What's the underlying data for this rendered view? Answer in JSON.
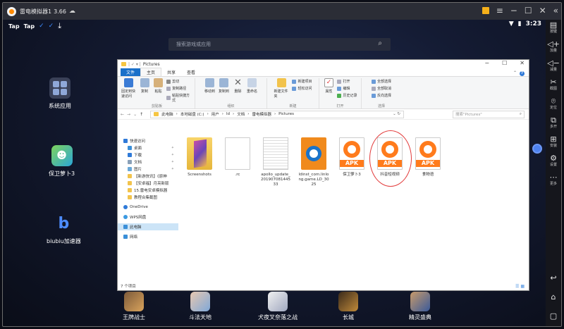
{
  "window": {
    "title": "雷电模拟器1",
    "version": "3.66"
  },
  "statusbar": {
    "app1": "Tap",
    "app2": "Tap",
    "time": "3:23"
  },
  "search": {
    "placeholder": "搜索游戏或应用"
  },
  "desktop": {
    "icons": [
      {
        "label": "系统应用"
      },
      {
        "label": "保卫萝卜3"
      },
      {
        "label": "biubiu加速器"
      }
    ]
  },
  "sidebar": {
    "items": [
      {
        "icon": "keyboard-icon",
        "label": "按键"
      },
      {
        "icon": "volume-up-icon",
        "label": "加量"
      },
      {
        "icon": "volume-down-icon",
        "label": "减量"
      },
      {
        "icon": "scissors-icon",
        "label": "截图"
      },
      {
        "icon": "location-icon",
        "label": "定位"
      },
      {
        "icon": "multi-open-icon",
        "label": "多开"
      },
      {
        "icon": "install-icon",
        "label": "安装"
      },
      {
        "icon": "settings-icon",
        "label": "设置"
      },
      {
        "icon": "more-icon",
        "label": "更多"
      }
    ]
  },
  "explorer": {
    "title": "Pictures",
    "tabs": [
      "文件",
      "主页",
      "共享",
      "查看"
    ],
    "ribbon": {
      "clipboard": {
        "group": "剪贴板",
        "pin": "固定到快速访问",
        "copy": "复制",
        "paste": "粘贴",
        "cut": "剪切",
        "copy_path": "复制路径",
        "paste_shortcut": "粘贴快捷方式"
      },
      "organize": {
        "group": "组织",
        "move_to": "移动到",
        "copy_to": "复制到",
        "delete": "删除",
        "rename": "重命名"
      },
      "new": {
        "group": "新建",
        "new_folder": "新建文件夹",
        "new_item": "新建项目",
        "easy_access": "轻松访问"
      },
      "open": {
        "group": "打开",
        "properties": "属性",
        "open": "打开",
        "edit": "编辑",
        "history": "历史记录"
      },
      "select": {
        "group": "选择",
        "select_all": "全部选择",
        "select_none": "全部取消",
        "invert": "反向选择"
      }
    },
    "address": {
      "crumbs": [
        "此电脑",
        "本地磁盘 (C:)",
        "用户",
        "ld",
        "文档",
        "雷电模拟器",
        "Pictures"
      ],
      "search_placeholder": "搜索\"Pictures\""
    },
    "nav": [
      {
        "label": "快速访问",
        "level": 0
      },
      {
        "label": "桌面",
        "level": 1
      },
      {
        "label": "下载",
        "level": 1
      },
      {
        "label": "文档",
        "level": 1
      },
      {
        "label": "图片",
        "level": 1
      },
      {
        "label": "【新游快讯】《原神",
        "level": 1
      },
      {
        "label": "【安卓福】月亮新版",
        "level": 1
      },
      {
        "label": "15.雷电安卓模拟器",
        "level": 1
      },
      {
        "label": "教程合集截图",
        "level": 1
      },
      {
        "label": "OneDrive",
        "level": 0
      },
      {
        "label": "WPS网盘",
        "level": 0
      },
      {
        "label": "此电脑",
        "level": 0
      },
      {
        "label": "网络",
        "level": 0
      }
    ],
    "files": [
      {
        "name": "Screenshots",
        "type": "folder"
      },
      {
        "name": ".rc",
        "type": "doc"
      },
      {
        "name": "apollo_update_20190708144533",
        "type": "doc2"
      },
      {
        "name": "ldinst_com.linlong.game.LD_3025",
        "type": "ldinst"
      },
      {
        "name": "保卫萝卜3",
        "type": "apk"
      },
      {
        "name": "抖音短视频",
        "type": "apk"
      },
      {
        "name": "食物语",
        "type": "apk"
      }
    ],
    "apk_tag": "APK",
    "status": "7 个项目"
  },
  "dock": [
    {
      "label": "王牌战士"
    },
    {
      "label": "斗法天地"
    },
    {
      "label": "犬夜叉奈落之战"
    },
    {
      "label": "长城"
    },
    {
      "label": "精灵盛典"
    }
  ]
}
